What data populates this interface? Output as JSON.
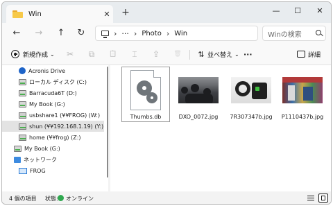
{
  "tab": {
    "title": "Win",
    "close": "✕",
    "new_tab": "+"
  },
  "window_controls": {
    "minimize": "—",
    "maximize": "☐",
    "close": "✕"
  },
  "nav": {
    "back": "←",
    "forward": "→",
    "up": "↑",
    "refresh": "↻"
  },
  "address": {
    "overflow": "···",
    "separator": "›",
    "crumbs": [
      "Photo",
      "Win"
    ]
  },
  "search": {
    "placeholder": "Winの検索"
  },
  "toolbar": {
    "new_label": "新規作成",
    "new_caret": "⌄",
    "cut": "✂",
    "copy": "⧉",
    "paste": "📋",
    "rename": "⌶",
    "share": "⇪",
    "delete": "🗑",
    "sort_label": "並べ替え",
    "sort_caret": "⌄",
    "more": "···",
    "details_label": "詳細"
  },
  "sidebar": {
    "items": [
      {
        "label": "Acronis Drive",
        "icon": "acronis-icon"
      },
      {
        "label": "ローカル ディスク (C:)",
        "icon": "local-disk-icon"
      },
      {
        "label": "Barracuda6T (D:)",
        "icon": "drive-icon"
      },
      {
        "label": "My Book (G:)",
        "icon": "drive-icon"
      },
      {
        "label": "usbshare1 (¥¥FROG) (W:)",
        "icon": "network-drive-icon"
      },
      {
        "label": "shun (¥¥192.168.1.19) (Y:)",
        "icon": "network-drive-icon",
        "selected": true
      },
      {
        "label": "home (¥¥frog) (Z:)",
        "icon": "network-drive-icon"
      },
      {
        "label": "My Book (G:)",
        "icon": "drive-icon"
      },
      {
        "label": "ネットワーク",
        "icon": "network-icon"
      },
      {
        "label": "FROG",
        "icon": "computer-icon"
      }
    ]
  },
  "files": [
    {
      "name": "Thumbs.db",
      "type": "system",
      "selected": true
    },
    {
      "name": "DXO_0072.jpg",
      "type": "photo"
    },
    {
      "name": "7R307347b.jpg",
      "type": "photo"
    },
    {
      "name": "P1110437b.jpg",
      "type": "photo"
    }
  ],
  "status": {
    "count": "4 個の項目",
    "state_label": "状態:",
    "state_value": "オンライン"
  }
}
